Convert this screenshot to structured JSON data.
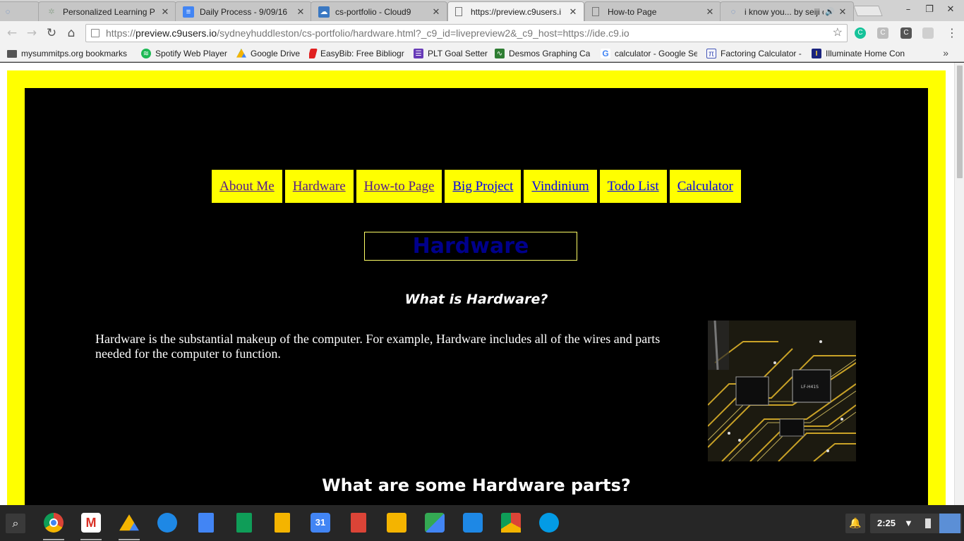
{
  "tabs": [
    {
      "title": "Personalized Learning P",
      "favicon": "spinner-icon",
      "active": false
    },
    {
      "title": "Daily Process - 9/09/16",
      "favicon": "docs-icon",
      "active": false
    },
    {
      "title": "cs-portfolio - Cloud9",
      "favicon": "cloud9-icon",
      "active": false
    },
    {
      "title": "https://preview.c9users.i",
      "favicon": "page-icon",
      "active": true
    },
    {
      "title": "How-to Page",
      "favicon": "page-icon",
      "active": false
    },
    {
      "title": "i know you... by seiji c",
      "favicon": "spinner-icon",
      "active": false
    }
  ],
  "tab_close_glyph": "✕",
  "omnibox": {
    "scheme": "https://",
    "host": "preview.c9users.io",
    "path": "/sydneyhuddleston/cs-portfolio/hardware.html?_c9_id=livepreview2&_c9_host=https://ide.c9.io"
  },
  "extensions": [
    {
      "label": "C",
      "name": "grammarly-icon",
      "color": "#15c39a"
    },
    {
      "label": "C",
      "name": "extension-c-icon",
      "color": "#bdbdbd"
    },
    {
      "label": "C",
      "name": "extension-c-dark-icon",
      "color": "#555555"
    },
    {
      "label": "",
      "name": "extension-copy-icon",
      "color": "#cfcfcf"
    }
  ],
  "bookmarks": [
    {
      "label": "mysummitps.org bookmarks",
      "icon": "folder-icon",
      "color": "#555555"
    },
    {
      "label": "Spotify Web Player",
      "icon": "spotify-icon",
      "color": "#1db954"
    },
    {
      "label": "Google Drive",
      "icon": "drive-icon",
      "color": "#f4b400"
    },
    {
      "label": "EasyBib: Free Bibliogr",
      "icon": "easybib-icon",
      "color": "#e02020"
    },
    {
      "label": "PLT Goal Setter",
      "icon": "plt-icon",
      "color": "#673ab7"
    },
    {
      "label": "Desmos Graphing Ca",
      "icon": "desmos-icon",
      "color": "#2e7d32"
    },
    {
      "label": "calculator - Google Se",
      "icon": "google-icon",
      "color": "#4285f4"
    },
    {
      "label": "Factoring Calculator -",
      "icon": "pi-icon",
      "color": "#3f51b5"
    },
    {
      "label": "Illuminate Home Con",
      "icon": "illuminate-icon",
      "color": "#1a237e"
    }
  ],
  "page": {
    "nav_links": [
      {
        "label": "About Me",
        "visited": true
      },
      {
        "label": "Hardware",
        "visited": true
      },
      {
        "label": "How-to Page",
        "visited": true
      },
      {
        "label": "Big Project",
        "visited": false
      },
      {
        "label": "Vindinium",
        "visited": false
      },
      {
        "label": "Todo List",
        "visited": false
      },
      {
        "label": "Calculator",
        "visited": false
      }
    ],
    "title": "Hardware",
    "subheading": "What is Hardware?",
    "body": "Hardware is the substantial makeup of the computer. For example, Hardware includes all of the wires and parts needed for the computer to function.",
    "section_heading": "What are some Hardware parts?",
    "colors": {
      "frame": "#ffff00",
      "background": "#000000",
      "title": "#00008b"
    }
  },
  "shelf": {
    "apps": [
      {
        "name": "chrome-icon",
        "label": "",
        "color": "#db4437"
      },
      {
        "name": "gmail-icon",
        "label": "M",
        "color": "#d93025"
      },
      {
        "name": "drive-icon",
        "label": "",
        "color": "#0f9d58"
      },
      {
        "name": "files-icon",
        "label": "",
        "color": "#1e88e5"
      },
      {
        "name": "docs-icon",
        "label": "",
        "color": "#4285f4"
      },
      {
        "name": "sheets-icon",
        "label": "",
        "color": "#0f9d58"
      },
      {
        "name": "slides-icon",
        "label": "",
        "color": "#f4b400"
      },
      {
        "name": "calendar-icon",
        "label": "31",
        "color": "#4285f4"
      },
      {
        "name": "pdf-icon",
        "label": "",
        "color": "#db4437"
      },
      {
        "name": "keep-icon",
        "label": "",
        "color": "#f4b400"
      },
      {
        "name": "maps-icon",
        "label": "",
        "color": "#34a853"
      },
      {
        "name": "classroom-icon",
        "label": "",
        "color": "#1e88e5"
      },
      {
        "name": "chrome-store-icon",
        "label": "",
        "color": "#9e9e9e"
      },
      {
        "name": "camera-icon",
        "label": "",
        "color": "#039be5"
      }
    ],
    "time": "2:25"
  }
}
